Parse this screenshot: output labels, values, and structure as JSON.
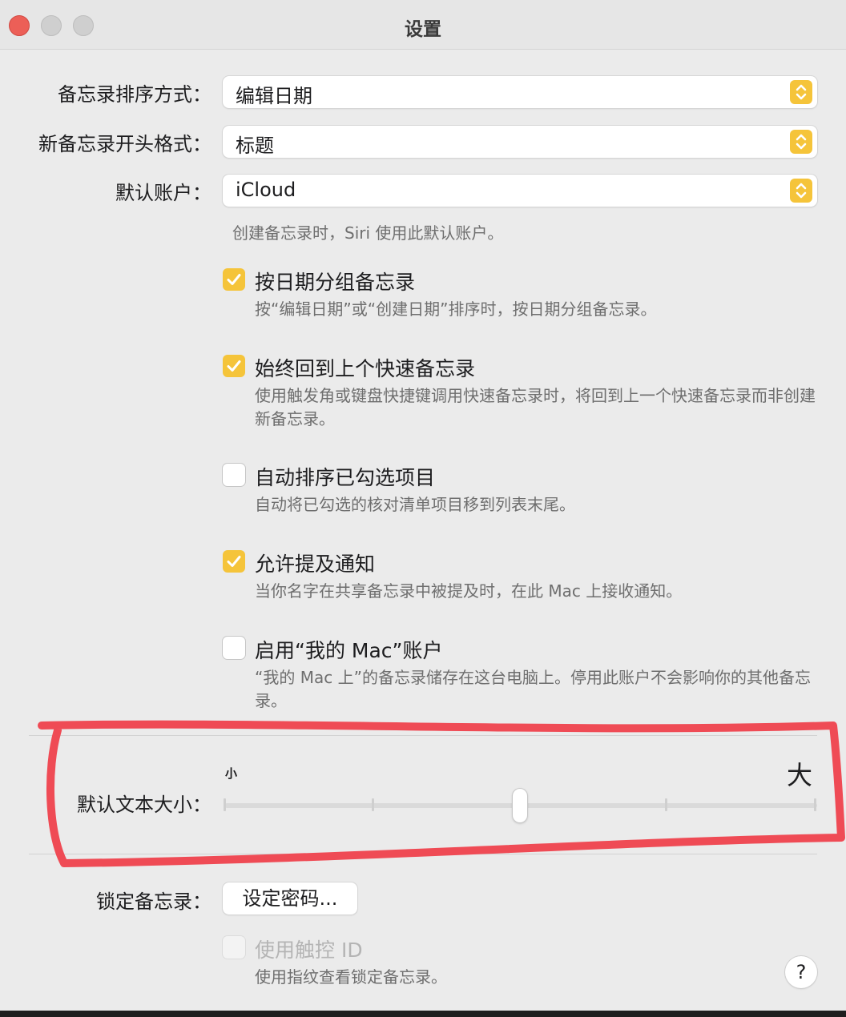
{
  "window": {
    "title": "设置"
  },
  "rows": {
    "sort_label": "备忘录排序方式：",
    "sort_value": "编辑日期",
    "new_note_label": "新备忘录开头格式：",
    "new_note_value": "标题",
    "default_account_label": "默认账户：",
    "default_account_value": "iCloud",
    "default_account_hint": "创建备忘录时，Siri 使用此默认账户。"
  },
  "options": [
    {
      "title": "按日期分组备忘录",
      "desc": "按“编辑日期”或“创建日期”排序时，按日期分组备忘录。",
      "checked": true
    },
    {
      "title": "始终回到上个快速备忘录",
      "desc": "使用触发角或键盘快捷键调用快速备忘录时，将回到上一个快速备忘录而非创建新备忘录。",
      "checked": true
    },
    {
      "title": "自动排序已勾选项目",
      "desc": "自动将已勾选的核对清单项目移到列表末尾。",
      "checked": false
    },
    {
      "title": "允许提及通知",
      "desc": "当你名字在共享备忘录中被提及时，在此 Mac 上接收通知。",
      "checked": true
    },
    {
      "title": "启用“我的 Mac”账户",
      "desc": "“我的 Mac 上”的备忘录储存在这台电脑上。停用此账户不会影响你的其他备忘录。",
      "checked": false
    }
  ],
  "text_size": {
    "label": "默认文本大小：",
    "small_label": "小",
    "large_label": "大",
    "level": 2,
    "max_level": 4
  },
  "lock": {
    "label": "锁定备忘录：",
    "button": "设定密码...",
    "touch_id_title": "使用触控 ID",
    "touch_id_desc": "使用指纹查看锁定备忘录。",
    "touch_id_enabled": false
  },
  "help": "?",
  "colors": {
    "accent": "#f5c43a",
    "annotation": "#ef4b55",
    "close_button": "#ec5f57"
  }
}
